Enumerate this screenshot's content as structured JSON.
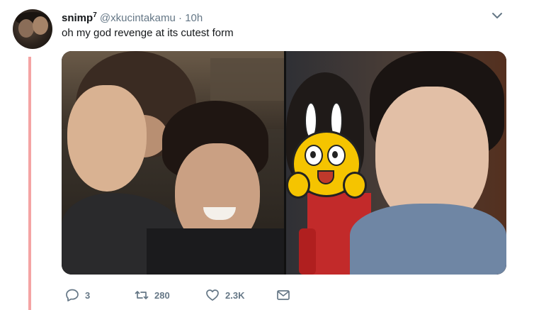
{
  "tweet": {
    "display_name": "snimp",
    "name_badge": "7",
    "handle": "@xkucintakamu",
    "separator": "·",
    "time": "10h",
    "text": "oh my god revenge at its cutest form"
  },
  "media": {
    "left_photo": "waving-selfie-photo",
    "right_photo": "selfie-with-sticker-photo"
  },
  "actions": {
    "replies": "3",
    "retweets": "280",
    "likes": "2.3K"
  },
  "colors": {
    "thread_line": "#f4a4a4",
    "muted": "#657786",
    "text": "#14171a"
  }
}
